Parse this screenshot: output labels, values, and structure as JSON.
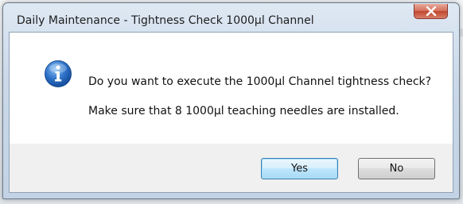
{
  "window": {
    "title": "Daily Maintenance - Tightness Check 1000µl Channel",
    "close_icon": "close-icon"
  },
  "message": {
    "icon": "info-icon",
    "line1": "Do you want to execute the 1000µl Channel tightness check?",
    "line2": "Make sure that 8 1000µl teaching needles are installed."
  },
  "buttons": {
    "yes_label": "Yes",
    "no_label": "No"
  },
  "colors": {
    "info_blue": "#1f5fb8",
    "close_red": "#c84a33",
    "default_button_border": "#3c7fb1"
  }
}
